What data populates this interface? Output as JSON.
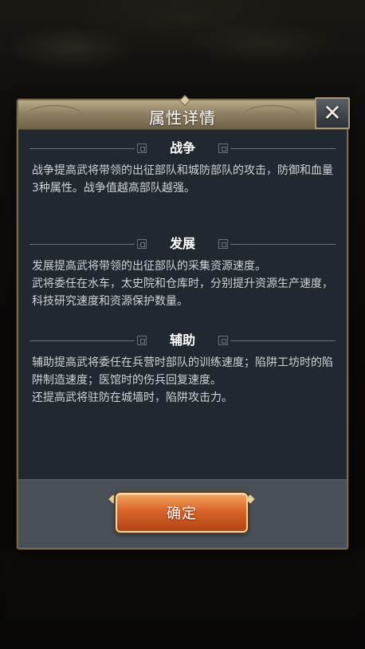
{
  "dialog": {
    "title": "属性详情",
    "close_symbol": "✕",
    "sections": [
      {
        "title": "战争",
        "body": "战争提高武将带领的出征部队和城防部队的攻击，防御和血量3种属性。战争值越高部队越强。"
      },
      {
        "title": "发展",
        "body": "发展提高武将带领的出征部队的采集资源速度。\n武将委任在水车，太史院和仓库时，分别提升资源生产速度，科技研究速度和资源保护数量。"
      },
      {
        "title": "辅助",
        "body": "辅助提高武将委任在兵营时部队的训练速度；陷阱工坊时的陷阱制造速度；医馆时的伤兵回复速度。\n还提高武将驻防在城墙时，陷阱攻击力。"
      }
    ],
    "confirm_label": "确定"
  }
}
